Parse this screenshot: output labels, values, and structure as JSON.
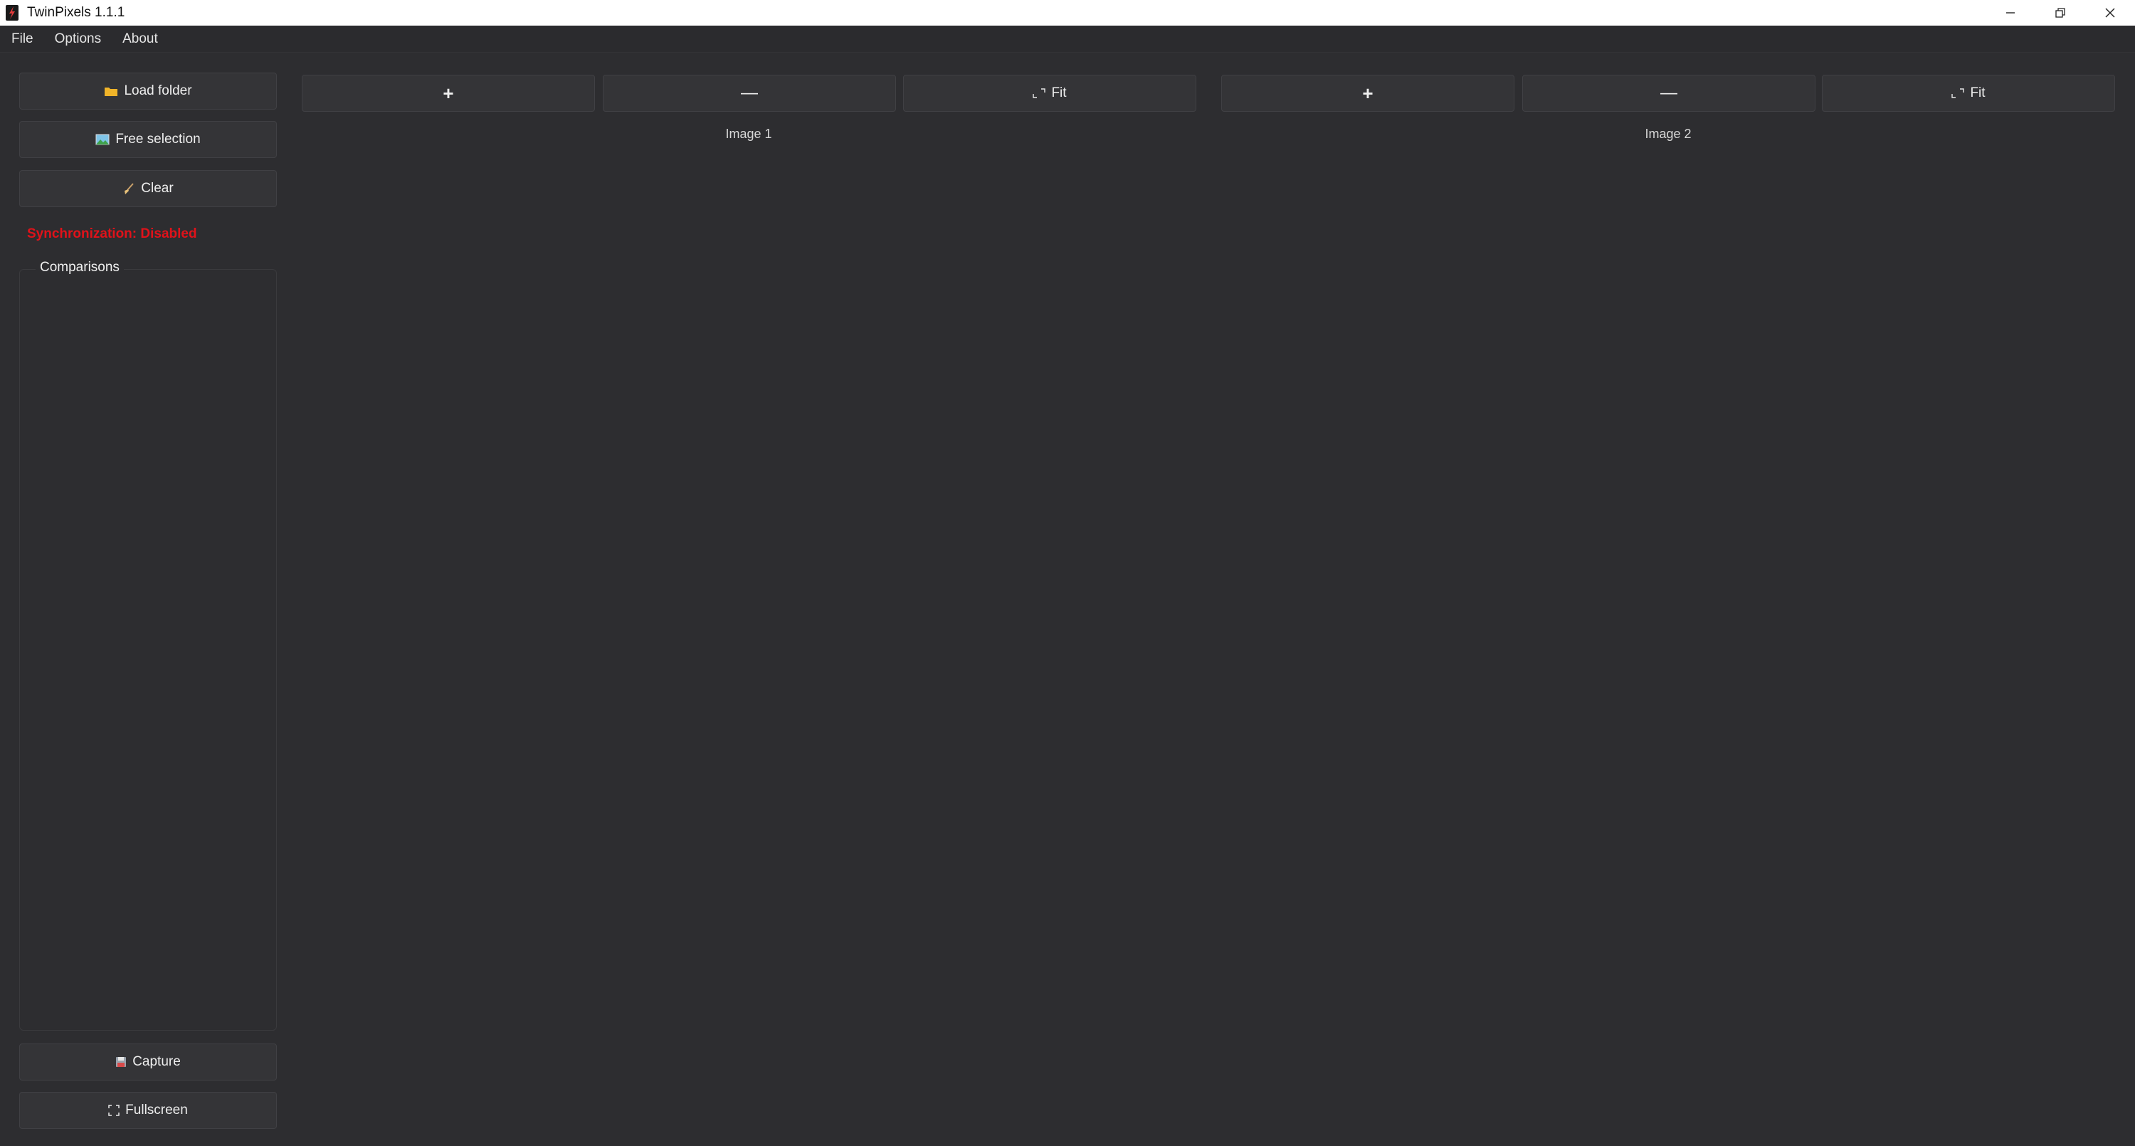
{
  "window": {
    "title": "TwinPixels 1.1.1"
  },
  "menu": {
    "items": [
      "File",
      "Options",
      "About"
    ]
  },
  "sidebar": {
    "load_folder": "Load folder",
    "free_selection": "Free selection",
    "clear": "Clear",
    "sync_status": "Synchronization: Disabled",
    "comparisons_title": "Comparisons",
    "capture": "Capture",
    "fullscreen": "Fullscreen"
  },
  "panel1": {
    "zoom_in": "+",
    "zoom_out": "—",
    "fit": "Fit",
    "label": "Image 1"
  },
  "panel2": {
    "zoom_in": "+",
    "zoom_out": "—",
    "fit": "Fit",
    "label": "Image 2"
  },
  "colors": {
    "background": "#2d2d30",
    "button": "#343437",
    "sync_disabled": "#e0121a",
    "folder_icon": "#f0b429"
  }
}
